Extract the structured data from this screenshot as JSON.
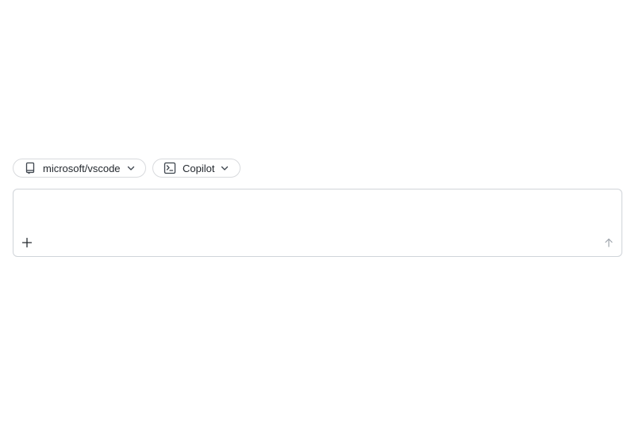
{
  "selectors": {
    "repository": {
      "label": "microsoft/vscode",
      "icon": "repo-icon"
    },
    "agent": {
      "label": "Copilot",
      "icon": "terminal-icon"
    }
  },
  "composer": {
    "value": "",
    "placeholder": "",
    "add_icon": "plus-icon",
    "send_icon": "arrow-up-icon"
  },
  "colors": {
    "border": "#d0d4d9",
    "text": "#24292f",
    "send_disabled": "#a0a6ad"
  }
}
